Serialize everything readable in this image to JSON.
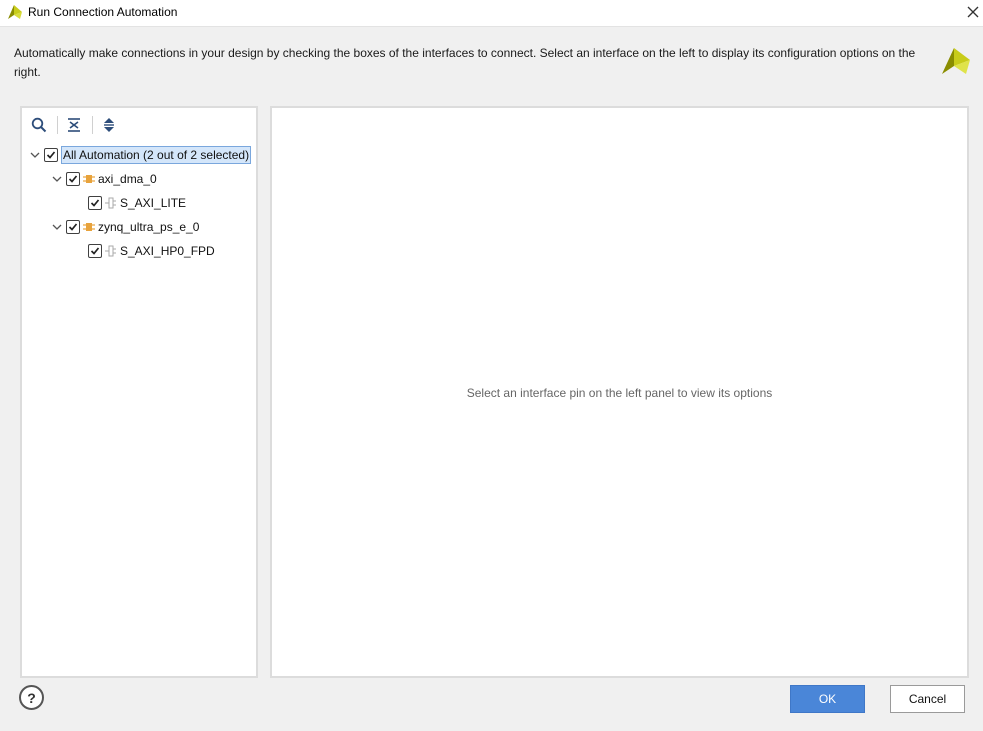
{
  "window": {
    "title": "Run Connection Automation",
    "logo_icon": "xilinx-logo-icon",
    "close_icon": "close-icon"
  },
  "description": "Automatically make connections in your design by checking the boxes of the interfaces to connect. Select an interface on the left to display its configuration options on the right.",
  "toolbar": {
    "icons": [
      "search-icon",
      "collapse-all-icon",
      "expand-all-icon"
    ]
  },
  "tree": {
    "root": {
      "label": "All Automation (2 out of 2 selected)",
      "checked": true,
      "expanded": true
    },
    "nodes": [
      {
        "label": "axi_dma_0",
        "checked": true,
        "expanded": true,
        "icon": "ip-block-icon",
        "children": [
          {
            "label": "S_AXI_LITE",
            "checked": true,
            "icon": "interface-pin-icon"
          }
        ]
      },
      {
        "label": "zynq_ultra_ps_e_0",
        "checked": true,
        "expanded": true,
        "icon": "ip-block-icon",
        "children": [
          {
            "label": "S_AXI_HP0_FPD",
            "checked": true,
            "icon": "interface-pin-icon"
          }
        ]
      }
    ]
  },
  "right_panel": {
    "message": "Select an interface pin on the left panel to view its options"
  },
  "footer": {
    "help_label": "?",
    "ok_label": "OK",
    "cancel_label": "Cancel"
  },
  "colors": {
    "accent": "#4a86d8",
    "ip_icon": "#e8a33c",
    "logo": "#b5b900"
  }
}
